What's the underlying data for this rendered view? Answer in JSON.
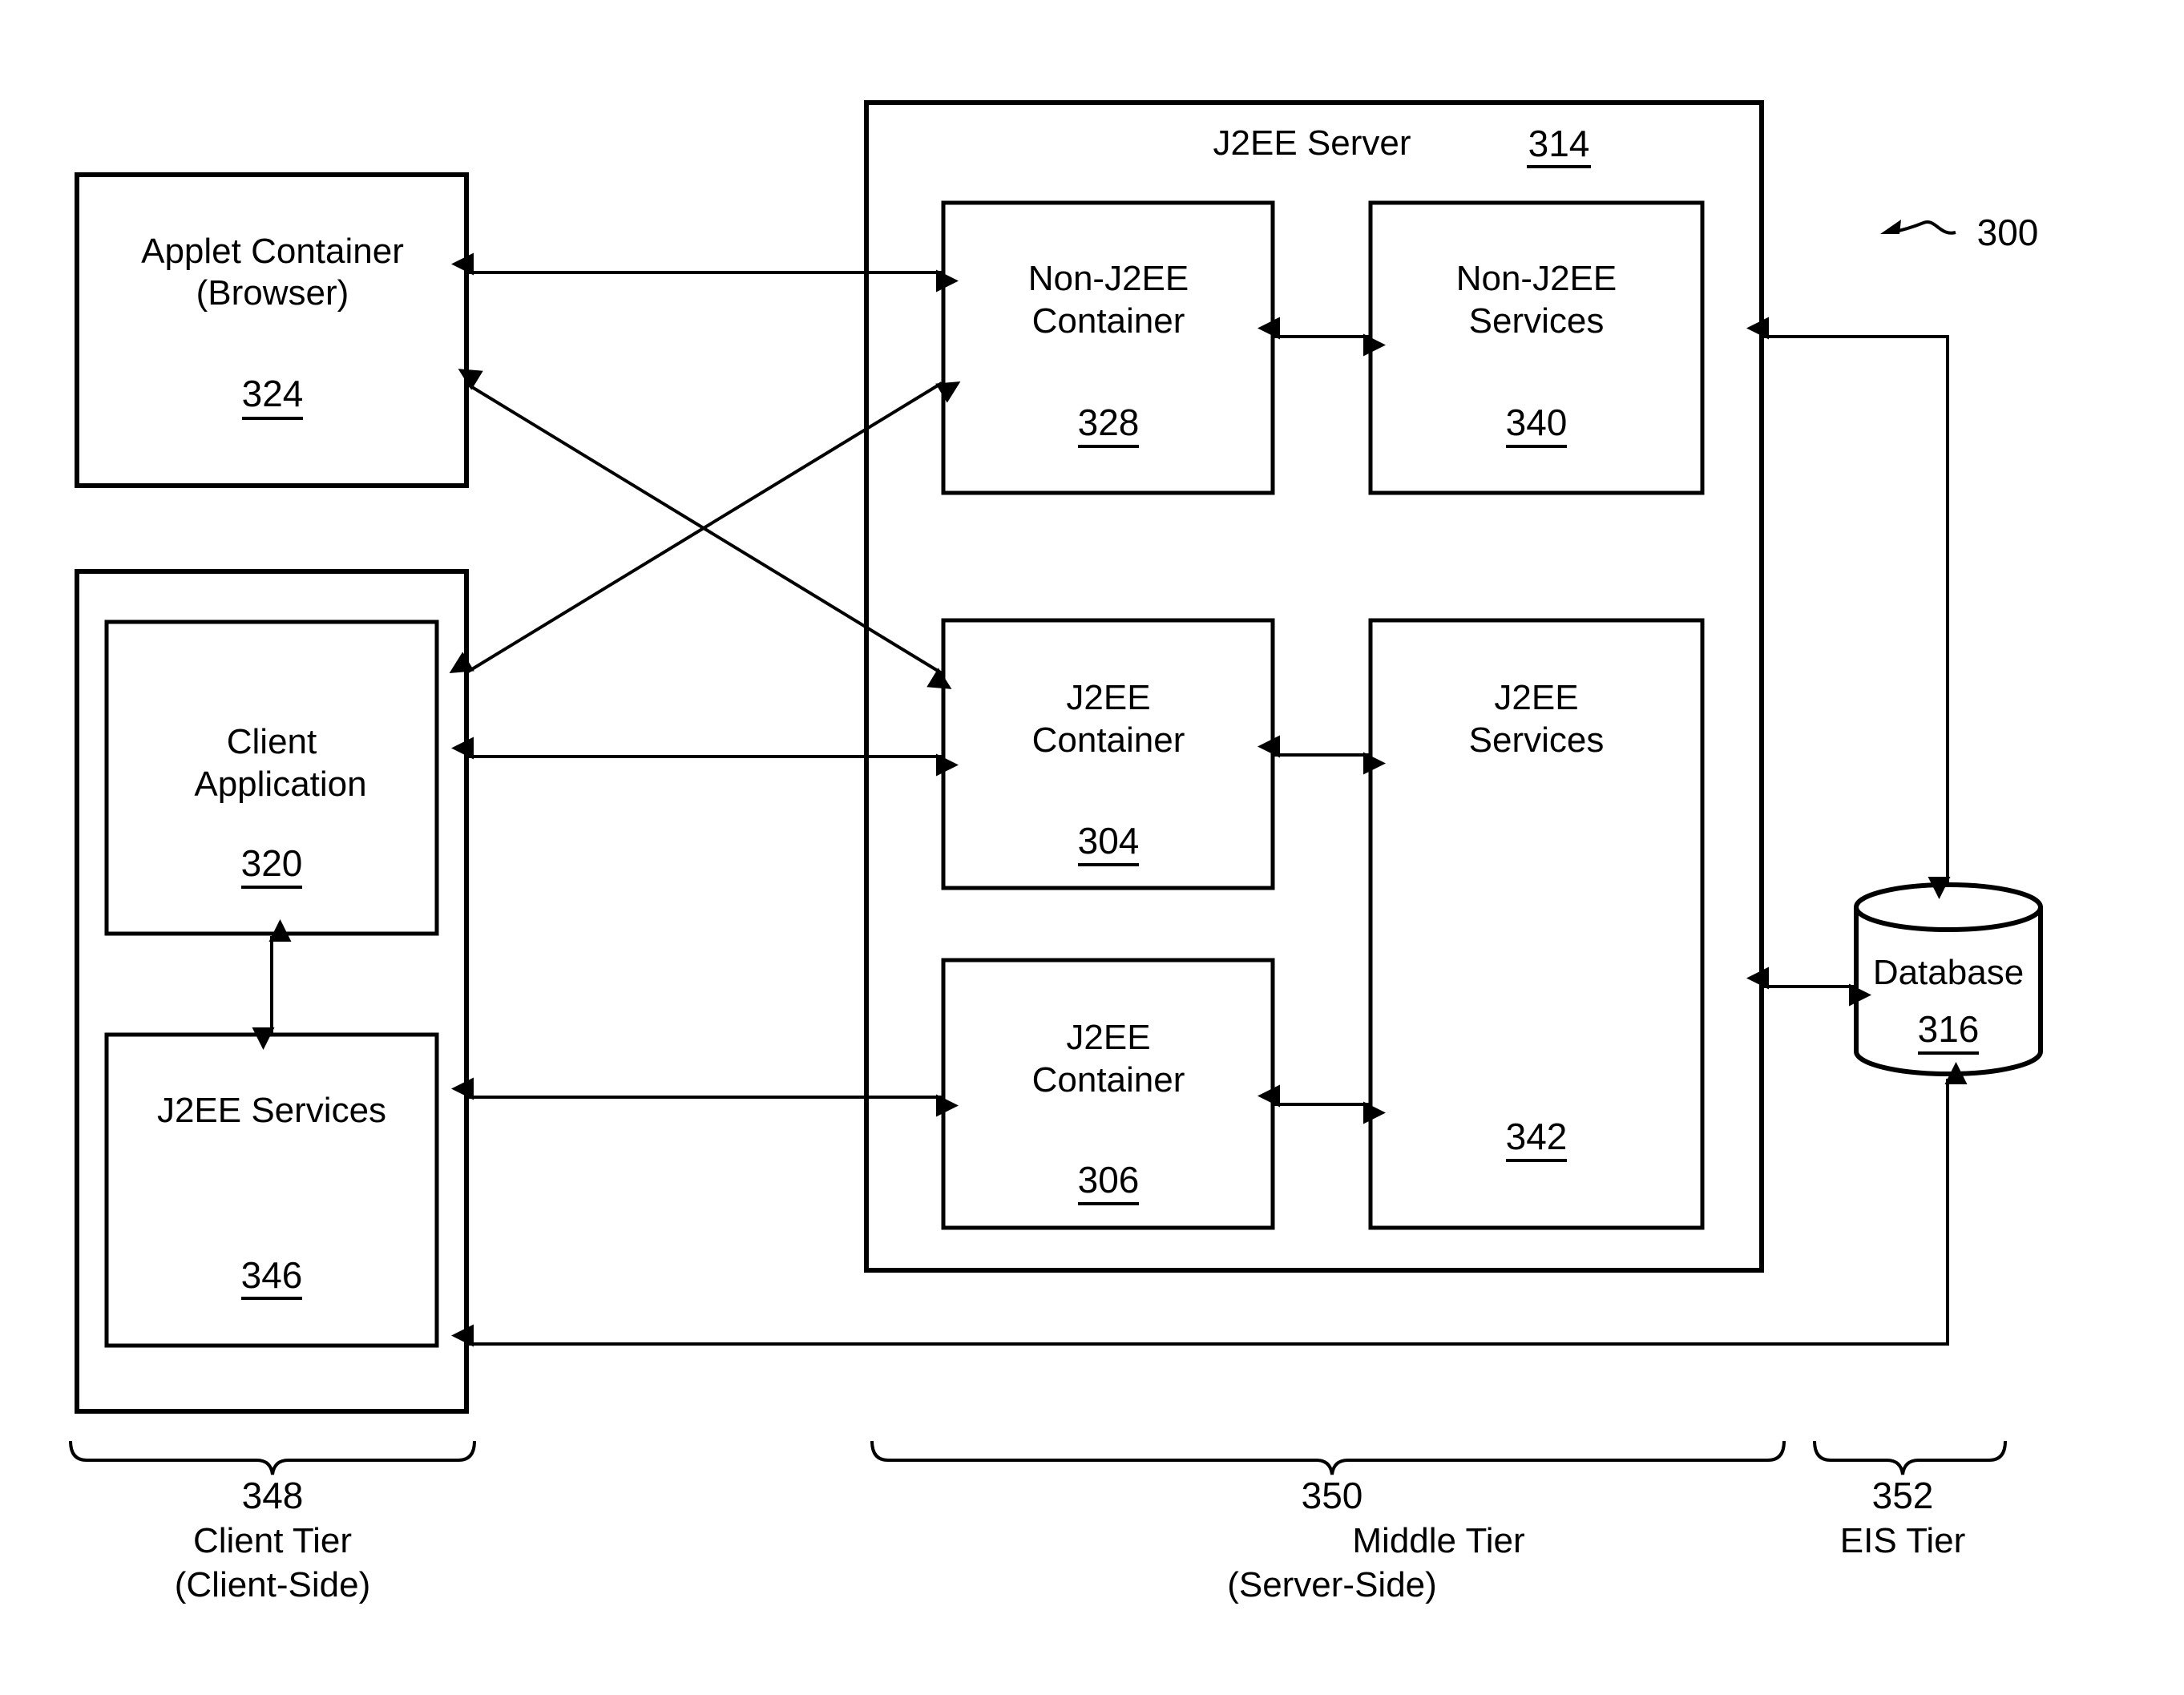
{
  "figure_ref": "300",
  "server": {
    "title": "J2EE Server",
    "ref": "314"
  },
  "applet_container": {
    "line1": "Applet Container",
    "line2": "(Browser)",
    "ref": "324"
  },
  "client_application": {
    "line1": "Client",
    "line2": "Application",
    "ref": "320"
  },
  "client_j2ee_services": {
    "line1": "J2EE Services",
    "ref": "346"
  },
  "non_j2ee_container": {
    "line1": "Non-J2EE",
    "line2": "Container",
    "ref": "328"
  },
  "non_j2ee_services": {
    "line1": "Non-J2EE",
    "line2": "Services",
    "ref": "340"
  },
  "j2ee_container_a": {
    "line1": "J2EE",
    "line2": "Container",
    "ref": "304"
  },
  "j2ee_container_b": {
    "line1": "J2EE",
    "line2": "Container",
    "ref": "306"
  },
  "j2ee_services": {
    "line1": "J2EE",
    "line2": "Services",
    "ref": "342"
  },
  "database": {
    "line1": "Database",
    "ref": "316"
  },
  "tiers": [
    {
      "ref": "348",
      "line1": "Client Tier",
      "line2": "(Client-Side)"
    },
    {
      "ref": "350",
      "line1": "Middle Tier",
      "line2": "(Server-Side)"
    },
    {
      "ref": "352",
      "line1": "EIS Tier",
      "line2": ""
    }
  ]
}
